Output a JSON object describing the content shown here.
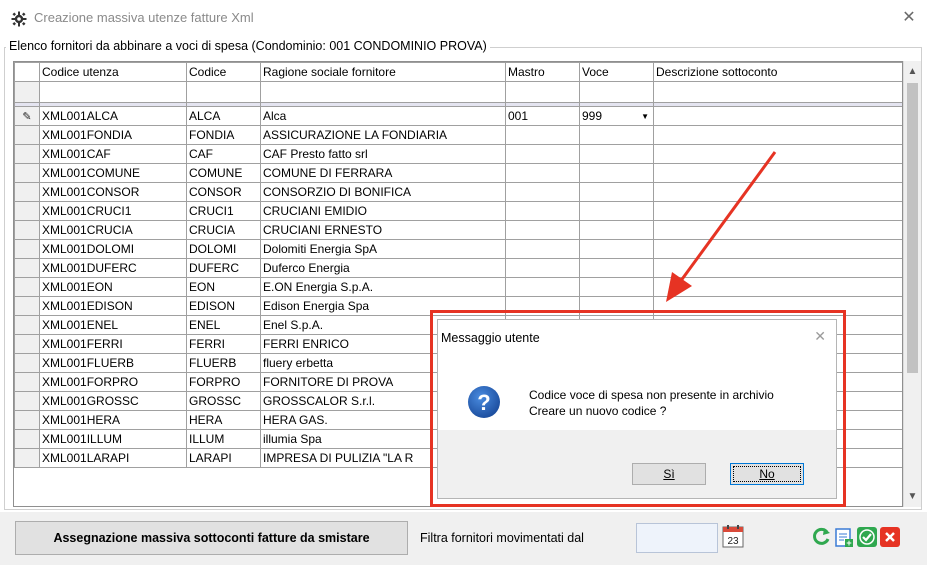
{
  "window": {
    "title": "Creazione massiva utenze fatture Xml",
    "icon": "gear-icon",
    "close_glyph": "✕"
  },
  "group": {
    "legend": "Elenco fornitori da abbinare a voci di spesa (Condominio: 001 CONDOMINIO PROVA)"
  },
  "grid": {
    "columns": [
      "Codice utenza",
      "Codice",
      "Ragione sociale fornitore",
      "Mastro",
      "Voce",
      "Descrizione sottoconto"
    ],
    "rows": [
      {
        "utenza": "XML001ALCA",
        "codice": "ALCA",
        "ragione": "Alca",
        "mastro": "001",
        "voce": "999",
        "descr": ""
      },
      {
        "utenza": "XML001FONDIA",
        "codice": "FONDIA",
        "ragione": "ASSICURAZIONE LA FONDIARIA",
        "mastro": "",
        "voce": "",
        "descr": ""
      },
      {
        "utenza": "XML001CAF",
        "codice": "CAF",
        "ragione": "CAF Presto fatto srl",
        "mastro": "",
        "voce": "",
        "descr": ""
      },
      {
        "utenza": "XML001COMUNE",
        "codice": "COMUNE",
        "ragione": "COMUNE DI FERRARA",
        "mastro": "",
        "voce": "",
        "descr": ""
      },
      {
        "utenza": "XML001CONSOR",
        "codice": "CONSOR",
        "ragione": "CONSORZIO DI BONIFICA",
        "mastro": "",
        "voce": "",
        "descr": ""
      },
      {
        "utenza": "XML001CRUCI1",
        "codice": "CRUCI1",
        "ragione": "CRUCIANI EMIDIO",
        "mastro": "",
        "voce": "",
        "descr": ""
      },
      {
        "utenza": "XML001CRUCIA",
        "codice": "CRUCIA",
        "ragione": "CRUCIANI ERNESTO",
        "mastro": "",
        "voce": "",
        "descr": ""
      },
      {
        "utenza": "XML001DOLOMI",
        "codice": "DOLOMI",
        "ragione": "Dolomiti Energia SpA",
        "mastro": "",
        "voce": "",
        "descr": ""
      },
      {
        "utenza": "XML001DUFERC",
        "codice": "DUFERC",
        "ragione": "Duferco Energia",
        "mastro": "",
        "voce": "",
        "descr": ""
      },
      {
        "utenza": "XML001EON",
        "codice": "EON",
        "ragione": "E.ON Energia S.p.A.",
        "mastro": "",
        "voce": "",
        "descr": ""
      },
      {
        "utenza": "XML001EDISON",
        "codice": "EDISON",
        "ragione": "Edison Energia Spa",
        "mastro": "",
        "voce": "",
        "descr": ""
      },
      {
        "utenza": "XML001ENEL",
        "codice": "ENEL",
        "ragione": "Enel S.p.A.",
        "mastro": "",
        "voce": "",
        "descr": ""
      },
      {
        "utenza": "XML001FERRI",
        "codice": "FERRI",
        "ragione": "FERRI ENRICO",
        "mastro": "",
        "voce": "",
        "descr": ""
      },
      {
        "utenza": "XML001FLUERB",
        "codice": "FLUERB",
        "ragione": "fluery erbetta",
        "mastro": "",
        "voce": "",
        "descr": ""
      },
      {
        "utenza": "XML001FORPRO",
        "codice": "FORPRO",
        "ragione": "FORNITORE DI PROVA",
        "mastro": "",
        "voce": "",
        "descr": ""
      },
      {
        "utenza": "XML001GROSSC",
        "codice": "GROSSC",
        "ragione": "GROSSCALOR S.r.l.",
        "mastro": "",
        "voce": "",
        "descr": ""
      },
      {
        "utenza": "XML001HERA",
        "codice": "HERA",
        "ragione": "HERA GAS.",
        "mastro": "",
        "voce": "",
        "descr": ""
      },
      {
        "utenza": "XML001ILLUM",
        "codice": "ILLUM",
        "ragione": "illumia Spa",
        "mastro": "",
        "voce": "",
        "descr": ""
      },
      {
        "utenza": "XML001LARAPI",
        "codice": "LARAPI",
        "ragione": "IMPRESA DI PULIZIA \"LA R",
        "mastro": "",
        "voce": "",
        "descr": ""
      }
    ],
    "editing_row_indicator": "pencil-icon"
  },
  "bottom": {
    "assign_button": "Assegnazione massiva sottoconti fatture da smistare",
    "filter_label": "Filtra fornitori movimentati dal",
    "date_value": "",
    "calendar_icon": "calendar-icon",
    "calendar_day": "23",
    "toolbar_icons": [
      "refresh-icon",
      "add-record-icon",
      "confirm-icon",
      "cancel-icon"
    ]
  },
  "dialog": {
    "title": "Messaggio utente",
    "close_glyph": "✕",
    "icon": "question-icon",
    "message_line1": "Codice voce di spesa non presente in archivio",
    "message_line2": "Creare un nuovo codice ?",
    "yes_label": "Sì",
    "no_label": "No"
  },
  "annotation": {
    "highlight_color": "#e63323"
  }
}
